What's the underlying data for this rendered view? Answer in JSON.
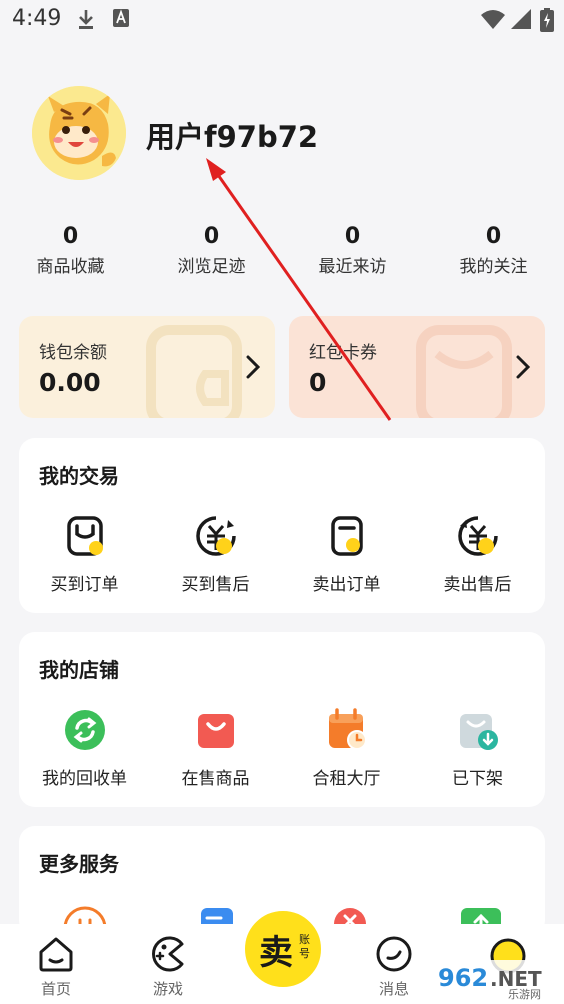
{
  "status_bar": {
    "time": "4:49"
  },
  "profile": {
    "username": "用户f97b72"
  },
  "stats": [
    {
      "value": "0",
      "label": "商品收藏"
    },
    {
      "value": "0",
      "label": "浏览足迹"
    },
    {
      "value": "0",
      "label": "最近来访"
    },
    {
      "value": "0",
      "label": "我的关注"
    }
  ],
  "wallet": {
    "balance_label": "钱包余额",
    "balance_value": "0.00",
    "coupon_label": "红包卡券",
    "coupon_value": "0"
  },
  "my_trades": {
    "title": "我的交易",
    "items": [
      {
        "label": "买到订单",
        "icon": "bag-icon"
      },
      {
        "label": "买到售后",
        "icon": "yuan-refund-icon"
      },
      {
        "label": "卖出订单",
        "icon": "sell-bag-icon"
      },
      {
        "label": "卖出售后",
        "icon": "yuan-aftersale-icon"
      }
    ]
  },
  "my_shop": {
    "title": "我的店铺",
    "items": [
      {
        "label": "我的回收单",
        "icon": "recycle-icon"
      },
      {
        "label": "在售商品",
        "icon": "shopping-bag-icon"
      },
      {
        "label": "合租大厅",
        "icon": "calendar-clock-icon"
      },
      {
        "label": "已下架",
        "icon": "download-bag-icon"
      }
    ]
  },
  "more_services": {
    "title": "更多服务"
  },
  "tabbar": {
    "home": "首页",
    "games": "游戏",
    "sell_main": "卖",
    "sell_sub": "账号",
    "messages": "消息"
  },
  "watermark": {
    "text": "962.NET",
    "sub": "乐游网"
  },
  "colors": {
    "accent_yellow": "#ffe01b",
    "wallet_bg": "#fbf0dc",
    "coupon_bg": "#fbe3d6",
    "arrow_red": "#e02020",
    "green": "#3cbf5a",
    "red": "#f25a52",
    "orange": "#f47c2a"
  }
}
